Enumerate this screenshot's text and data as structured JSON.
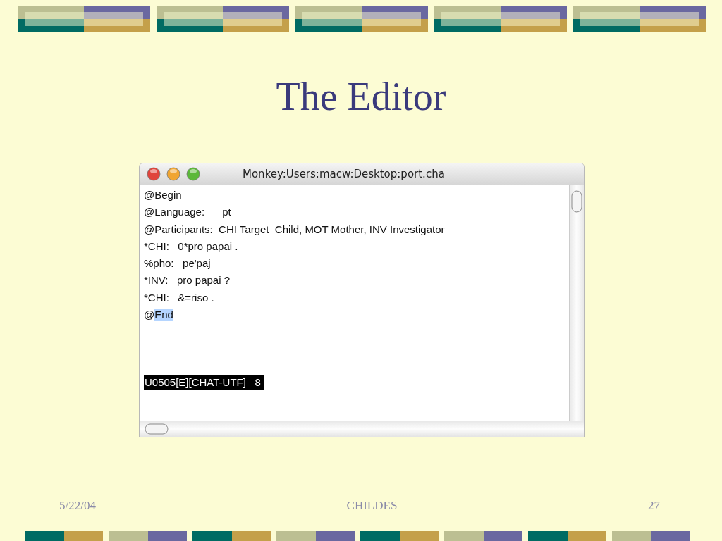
{
  "slide": {
    "title": "The Editor"
  },
  "window": {
    "title": "Monkey:Users:macw:Desktop:port.cha",
    "lines": [
      {
        "text": "@Begin"
      },
      {
        "text": "@Language:      pt"
      },
      {
        "text": "@Participants:  CHI Target_Child, MOT Mother, INV Investigator"
      },
      {
        "text": "*CHI:   0*pro papai ."
      },
      {
        "text": "%pho:   pe'paj"
      },
      {
        "text": "*INV:   pro papai ?"
      },
      {
        "text": "*CHI:   &=riso ."
      },
      {
        "text": "@",
        "selection": "End"
      }
    ],
    "status_line": "U0505[E][CHAT-UTF]   8"
  },
  "footer": {
    "date": "5/22/04",
    "center": "CHILDES",
    "page": "27"
  }
}
